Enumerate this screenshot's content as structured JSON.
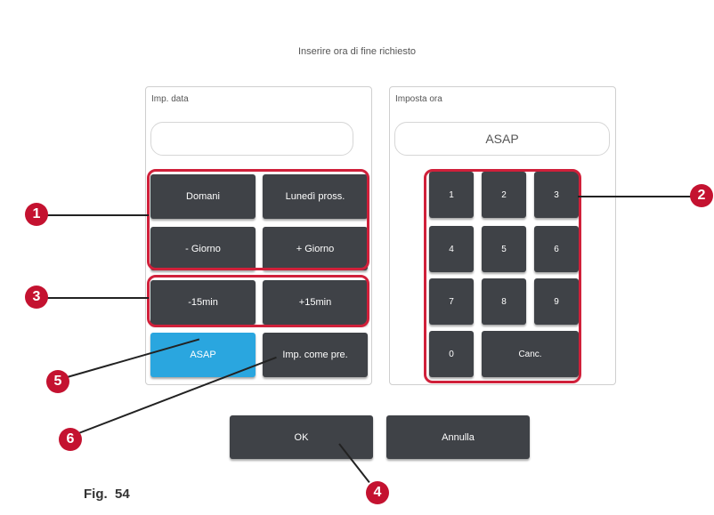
{
  "header": {
    "title": "Inserire ora di fine richiesto"
  },
  "date_panel": {
    "title": "Imp. data",
    "value": "",
    "buttons": {
      "tomorrow": "Domani",
      "next_monday": "Lunedì pross.",
      "minus_day": "- Giorno",
      "plus_day": "+ Giorno",
      "minus_15": "-15min",
      "plus_15": "+15min",
      "asap": "ASAP",
      "set_default": "Imp. come pre."
    }
  },
  "time_panel": {
    "title": "Imposta ora",
    "value": "ASAP",
    "keys": [
      "1",
      "2",
      "3",
      "4",
      "5",
      "6",
      "7",
      "8",
      "9",
      "0"
    ],
    "clear": "Canc."
  },
  "footer": {
    "ok": "OK",
    "cancel": "Annulla"
  },
  "callouts": [
    "1",
    "2",
    "3",
    "4",
    "5",
    "6"
  ],
  "figure_caption": "Fig.  54",
  "colors": {
    "highlight": "#d0203a",
    "badge": "#c41230",
    "button": "#3f4247",
    "accent": "#2aa6df"
  }
}
